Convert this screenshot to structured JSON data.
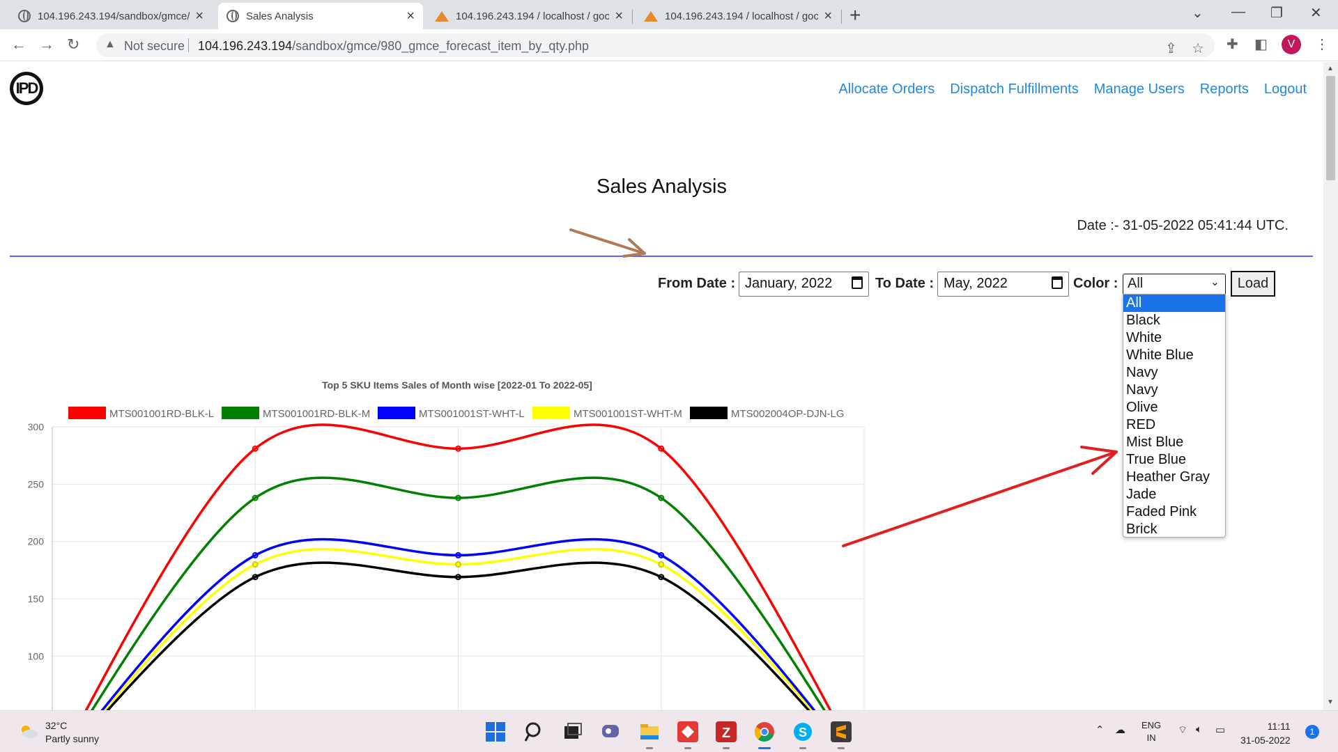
{
  "browser": {
    "tabs": [
      {
        "title": "104.196.243.194/sandbox/gmce/",
        "icon": "globe-icon",
        "active": false
      },
      {
        "title": "Sales Analysis",
        "icon": "globe-icon",
        "active": true
      },
      {
        "title": "104.196.243.194 / localhost / goc",
        "icon": "phpmyadmin-icon",
        "active": false
      },
      {
        "title": "104.196.243.194 / localhost / goc",
        "icon": "phpmyadmin-icon",
        "active": false
      }
    ],
    "security_label": "Not secure",
    "url_host": "104.196.243.194",
    "url_path": "/sandbox/gmce/980_gmce_forecast_item_by_qty.php",
    "profile_initial": "V"
  },
  "nav": [
    "Allocate Orders",
    "Dispatch Fulfillments",
    "Manage Users",
    "Reports",
    "Logout"
  ],
  "page": {
    "logo": "IPD",
    "title": "Sales Analysis",
    "date_stamp": "Date :- 31-05-2022 05:41:44 UTC."
  },
  "filters": {
    "from_label": "From Date :",
    "from_value": "January, 2022",
    "to_label": "To Date :",
    "to_value": "May, 2022",
    "color_label": "Color :",
    "color_value": "All",
    "load_label": "Load",
    "color_options": [
      "All",
      "Black",
      "White",
      "White Blue",
      "Navy",
      "Navy",
      "Olive",
      "RED",
      "Mist Blue",
      "True Blue",
      "Heather Gray",
      "Jade",
      "Faded Pink",
      "Brick"
    ]
  },
  "chart_data": {
    "type": "line",
    "title": "Top 5 SKU Items Sales of Month wise [2022-01 To 2022-05]",
    "ylim": [
      0,
      300
    ],
    "yticks": [
      50,
      100,
      150,
      200,
      250,
      300
    ],
    "grid": true,
    "legend_position": "top",
    "x_points": 5,
    "series": [
      {
        "name": "MTS001001RD-BLK-L",
        "color": "#ff0000",
        "values": [
          0,
          281,
          281,
          281,
          0
        ]
      },
      {
        "name": "MTS001001RD-BLK-M",
        "color": "#008000",
        "values": [
          0,
          238,
          238,
          238,
          0
        ]
      },
      {
        "name": "MTS001001ST-WHT-L",
        "color": "#0000ff",
        "values": [
          0,
          188,
          188,
          188,
          0
        ]
      },
      {
        "name": "MTS001001ST-WHT-M",
        "color": "#ffff00",
        "values": [
          0,
          180,
          180,
          180,
          0
        ]
      },
      {
        "name": "MTS002004OP-DJN-LG",
        "color": "#000000",
        "values": [
          0,
          169,
          169,
          169,
          0
        ]
      }
    ]
  },
  "taskbar": {
    "temperature": "32°C",
    "weather": "Partly sunny",
    "lang_top": "ENG",
    "lang_bottom": "IN",
    "time": "11:11",
    "date": "31-05-2022",
    "notifications": "1"
  }
}
